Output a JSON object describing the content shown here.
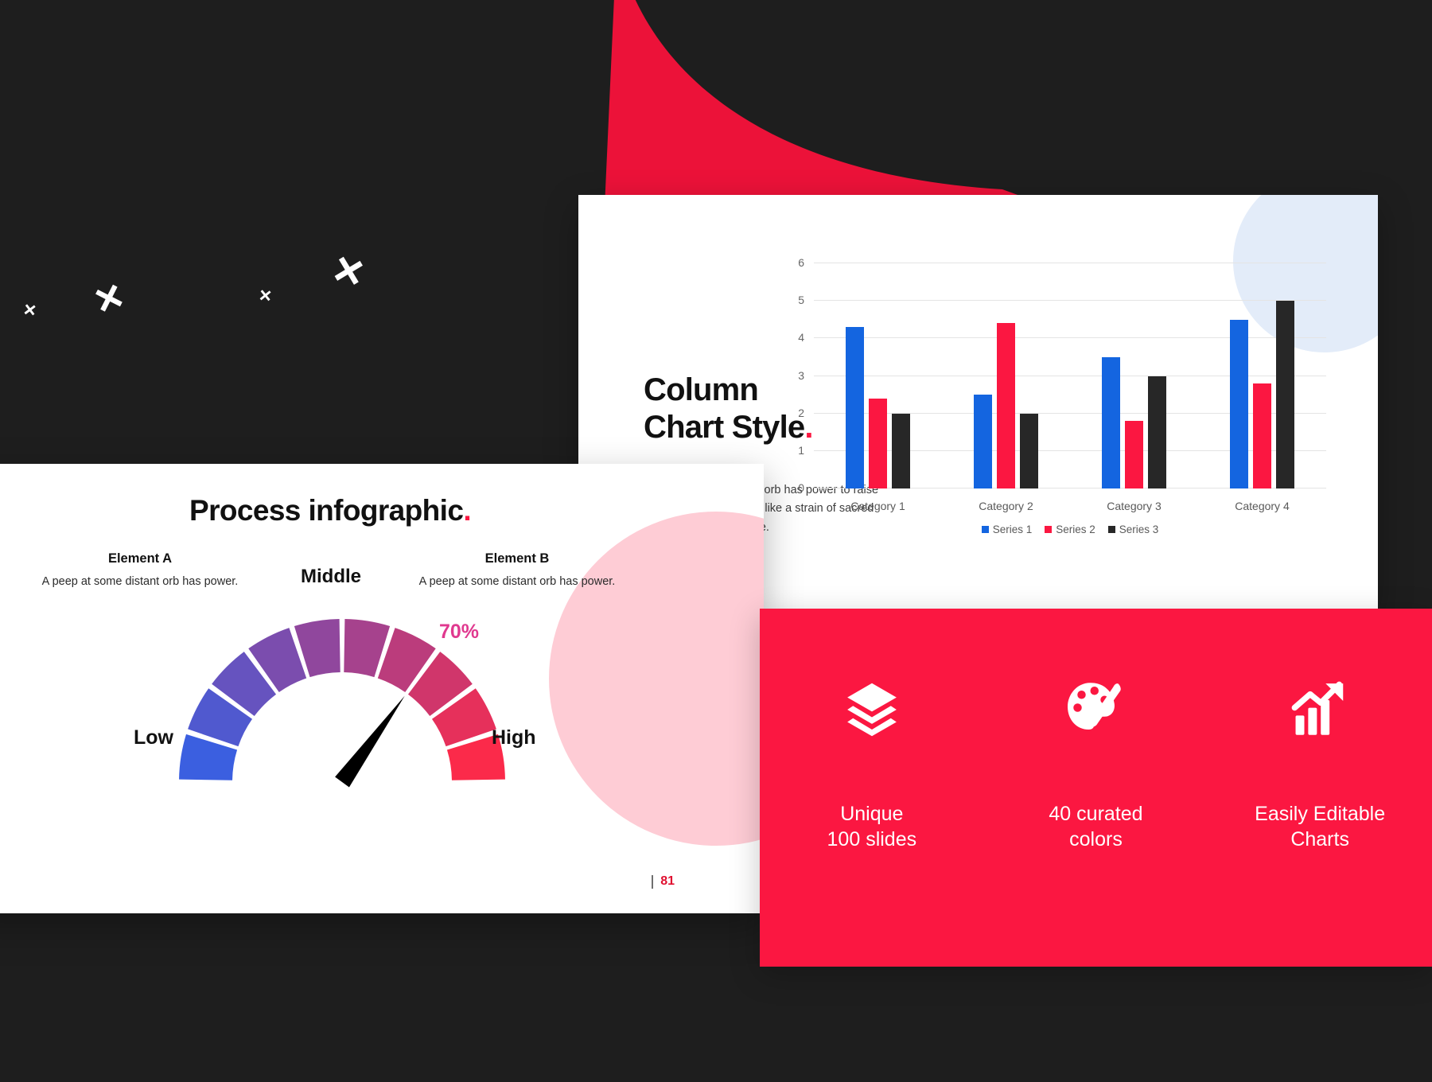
{
  "background": {
    "color": "#1e1e1e",
    "accent_red": "#ec1239",
    "decor_marks": [
      {
        "name": "x-mark-small-1",
        "glyph": "×"
      },
      {
        "name": "x-mark-large-1",
        "glyph": "×"
      },
      {
        "name": "x-mark-small-2",
        "glyph": "×"
      },
      {
        "name": "x-mark-large-2",
        "glyph": "×"
      }
    ]
  },
  "chart_slide": {
    "title_line1": "Column",
    "title_line2": "Chart Style",
    "title_dot": ".",
    "body_text": "A peep at some distant orb has power to raise and purify our thoughts like a strain of sacred music or a noble picture.",
    "circle_color": "#e3ecf9"
  },
  "chart_data": {
    "type": "bar",
    "title": "Column Chart Style",
    "categories": [
      "Category 1",
      "Category 2",
      "Category 3",
      "Category 4"
    ],
    "series": [
      {
        "name": "Series 1",
        "color": "#1465e0",
        "values": [
          4.3,
          2.5,
          3.5,
          4.5
        ]
      },
      {
        "name": "Series 2",
        "color": "#fb1741",
        "values": [
          2.4,
          4.4,
          1.8,
          2.8
        ]
      },
      {
        "name": "Series 3",
        "color": "#272727",
        "values": [
          2.0,
          2.0,
          3.0,
          5.0
        ]
      }
    ],
    "yticks": [
      0,
      1,
      2,
      3,
      4,
      5,
      6
    ],
    "ylim": [
      0,
      6
    ],
    "xlabel": "",
    "ylabel": "",
    "grid": true,
    "legend_position": "bottom"
  },
  "process_slide": {
    "title": "Process infographic",
    "title_dot": ".",
    "element_a": {
      "title": "Element A",
      "desc": "A peep at some distant orb has power."
    },
    "element_b": {
      "title": "Element B",
      "desc": "A peep at some distant orb has power."
    },
    "gauge": {
      "label_low": "Low",
      "label_middle": "Middle",
      "label_high": "High",
      "percent": "70%",
      "percent_color": "#e0398f",
      "value": 70,
      "segments": 10,
      "color_start": "#3b5fe0",
      "color_end": "#fb2a4a"
    },
    "page_number": "81"
  },
  "features_panel": {
    "background": "#fb1741",
    "items": [
      {
        "icon": "layers-icon",
        "label_line1": "Unique",
        "label_line2": "100 slides"
      },
      {
        "icon": "palette-icon",
        "label_line1": "40 curated",
        "label_line2": "colors"
      },
      {
        "icon": "growth-chart-icon",
        "label_line1": "Easily Editable",
        "label_line2": "Charts"
      }
    ]
  }
}
